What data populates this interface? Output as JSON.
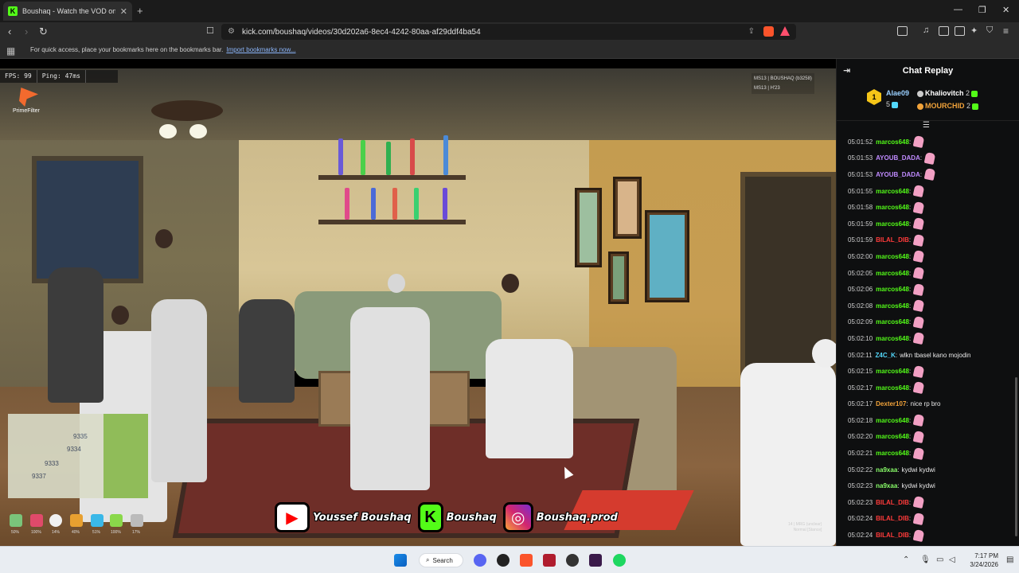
{
  "browser": {
    "tab_title": "Boushaq - Watch the VOD on Kick",
    "url": "kick.com/boushaq/videos/30d202a6-8ec4-4242-80aa-af29ddf4ba54",
    "bookmarks_msg": "For quick access, place your bookmarks here on the bookmarks bar.",
    "bookmarks_link": "Import bookmarks now..."
  },
  "hud": {
    "fps": "FPS: 99",
    "ping": "Ping: 47ms",
    "brand": "PrimeFilter",
    "top_right_line1": "MS13 | BOUSHAQ (b3258)",
    "top_right_line2": "MS13 | H'23",
    "watermark_line1": "14 | MRG (unclear)",
    "watermark_line2": "Normal [Stance]",
    "status_pcts": [
      "50%",
      "100%",
      "14%",
      "40%",
      "51%",
      "100%",
      "17%"
    ]
  },
  "socials": {
    "youtube": "Youssef Boushaq",
    "kick": "Boushaq",
    "instagram": "Boushaq.prod"
  },
  "chat": {
    "title": "Chat Replay",
    "leaderboard": {
      "first_rank": "1",
      "first_name": "Alae09",
      "first_count": "5",
      "second_name": "Khaliovitch",
      "second_count": "2",
      "third_name": "MOURCHID",
      "third_count": "2"
    },
    "messages": [
      {
        "time": "05:01:52",
        "user": "marcos648",
        "color": "#53fc18",
        "text": ""
      },
      {
        "time": "05:01:53",
        "user": "AYOUB_DADA",
        "color": "#c08bff",
        "text": ""
      },
      {
        "time": "05:01:53",
        "user": "AYOUB_DADA",
        "color": "#c08bff",
        "text": ""
      },
      {
        "time": "05:01:55",
        "user": "marcos648",
        "color": "#53fc18",
        "text": ""
      },
      {
        "time": "05:01:58",
        "user": "marcos648",
        "color": "#53fc18",
        "text": ""
      },
      {
        "time": "05:01:59",
        "user": "marcos648",
        "color": "#53fc18",
        "text": ""
      },
      {
        "time": "05:01:59",
        "user": "BILAL_DIB",
        "color": "#ff3b3b",
        "text": ""
      },
      {
        "time": "05:02:00",
        "user": "marcos648",
        "color": "#53fc18",
        "text": ""
      },
      {
        "time": "05:02:05",
        "user": "marcos648",
        "color": "#53fc18",
        "text": ""
      },
      {
        "time": "05:02:06",
        "user": "marcos648",
        "color": "#53fc18",
        "text": ""
      },
      {
        "time": "05:02:08",
        "user": "marcos648",
        "color": "#53fc18",
        "text": ""
      },
      {
        "time": "05:02:09",
        "user": "marcos648",
        "color": "#53fc18",
        "text": ""
      },
      {
        "time": "05:02:10",
        "user": "marcos648",
        "color": "#53fc18",
        "text": ""
      },
      {
        "time": "05:02:11",
        "user": "Z4C_K",
        "color": "#53d8fc",
        "text": "wlkn tbasel kano mojodin"
      },
      {
        "time": "05:02:15",
        "user": "marcos648",
        "color": "#53fc18",
        "text": ""
      },
      {
        "time": "05:02:17",
        "user": "marcos648",
        "color": "#53fc18",
        "text": ""
      },
      {
        "time": "05:02:17",
        "user": "Dexter107",
        "color": "#f2a33a",
        "text": "nice rp bro"
      },
      {
        "time": "05:02:18",
        "user": "marcos648",
        "color": "#53fc18",
        "text": ""
      },
      {
        "time": "05:02:20",
        "user": "marcos648",
        "color": "#53fc18",
        "text": ""
      },
      {
        "time": "05:02:21",
        "user": "marcos648",
        "color": "#53fc18",
        "text": ""
      },
      {
        "time": "05:02:22",
        "user": "na9xaa",
        "color": "#8aff6a",
        "text": "kydwi kydwi"
      },
      {
        "time": "05:02:23",
        "user": "na9xaa",
        "color": "#8aff6a",
        "text": "kydwi kydwi"
      },
      {
        "time": "05:02:23",
        "user": "BILAL_DIB",
        "color": "#ff3b3b",
        "text": ""
      },
      {
        "time": "05:02:24",
        "user": "BILAL_DIB",
        "color": "#ff3b3b",
        "text": ""
      },
      {
        "time": "05:02:24",
        "user": "BILAL_DIB",
        "color": "#ff3b3b",
        "text": ""
      }
    ]
  },
  "taskbar": {
    "search": "Search",
    "time": "7:17 PM",
    "date": "3/24/2026"
  }
}
